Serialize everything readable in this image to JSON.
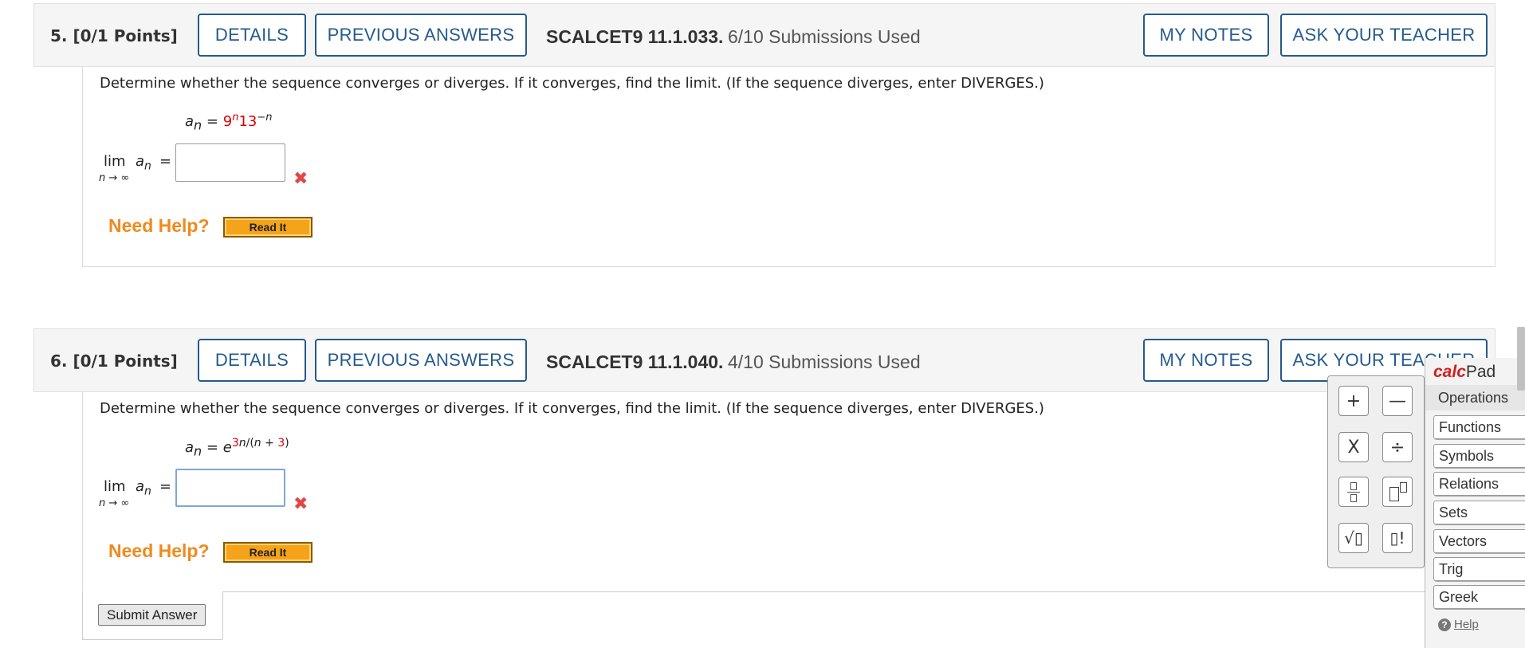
{
  "questions": [
    {
      "number": "5.",
      "points": "[0/1 Points]",
      "details_label": "DETAILS",
      "prev_answers_label": "PREVIOUS ANSWERS",
      "code": "SCALCET9 11.1.033.",
      "submissions": "6/10 Submissions Used",
      "my_notes_label": "MY NOTES",
      "ask_teacher_label": "ASK YOUR TEACHER",
      "prompt": "Determine whether the sequence converges or diverges. If it converges, find the limit. (If the sequence diverges, enter DIVERGES.)",
      "formula": {
        "lhs": "a",
        "sub": "n",
        "eq": "=",
        "base1": "9",
        "exp1": "n",
        "base2": "13",
        "exp2": "−n"
      },
      "limit": {
        "lim": "lim",
        "under": "n → ∞",
        "an": "a",
        "sub": "n",
        "eq": "="
      },
      "answer_value": "",
      "status": "incorrect",
      "need_help": "Need Help?",
      "read_it": "Read It"
    },
    {
      "number": "6.",
      "points": "[0/1 Points]",
      "details_label": "DETAILS",
      "prev_answers_label": "PREVIOUS ANSWERS",
      "code": "SCALCET9 11.1.040.",
      "submissions": "4/10 Submissions Used",
      "my_notes_label": "MY NOTES",
      "ask_teacher_label": "ASK YOUR TEACHER",
      "prompt": "Determine whether the sequence converges or diverges. If it converges, find the limit. (If the sequence diverges, enter DIVERGES.)",
      "formula": {
        "lhs": "a",
        "sub": "n",
        "eq": "=",
        "base": "e",
        "exp_num": "3",
        "exp_var": "n",
        "exp_mid": "/(",
        "exp_var2": "n",
        "exp_plus": " + ",
        "exp_const": "3",
        "exp_close": ")"
      },
      "limit": {
        "lim": "lim",
        "under": "n → ∞",
        "an": "a",
        "sub": "n",
        "eq": "="
      },
      "answer_value": "",
      "status": "incorrect",
      "need_help": "Need Help?",
      "read_it": "Read It"
    }
  ],
  "submit_label": "Submit Answer",
  "calcpad": {
    "title_part1": "calc",
    "title_part2": "Pad",
    "active_tab": "Operations",
    "buttons": [
      "+",
      "—",
      "X",
      "÷",
      "⁄",
      "▯▯",
      "√▯",
      "▯!"
    ],
    "categories": [
      "Functions",
      "Symbols",
      "Relations",
      "Sets",
      "Vectors",
      "Trig",
      "Greek"
    ],
    "help_label": "Help"
  },
  "colors": {
    "accent": "#245a8e",
    "need_help": "#f08a1c",
    "error": "#e04848",
    "brand_red": "#d41e1e"
  }
}
